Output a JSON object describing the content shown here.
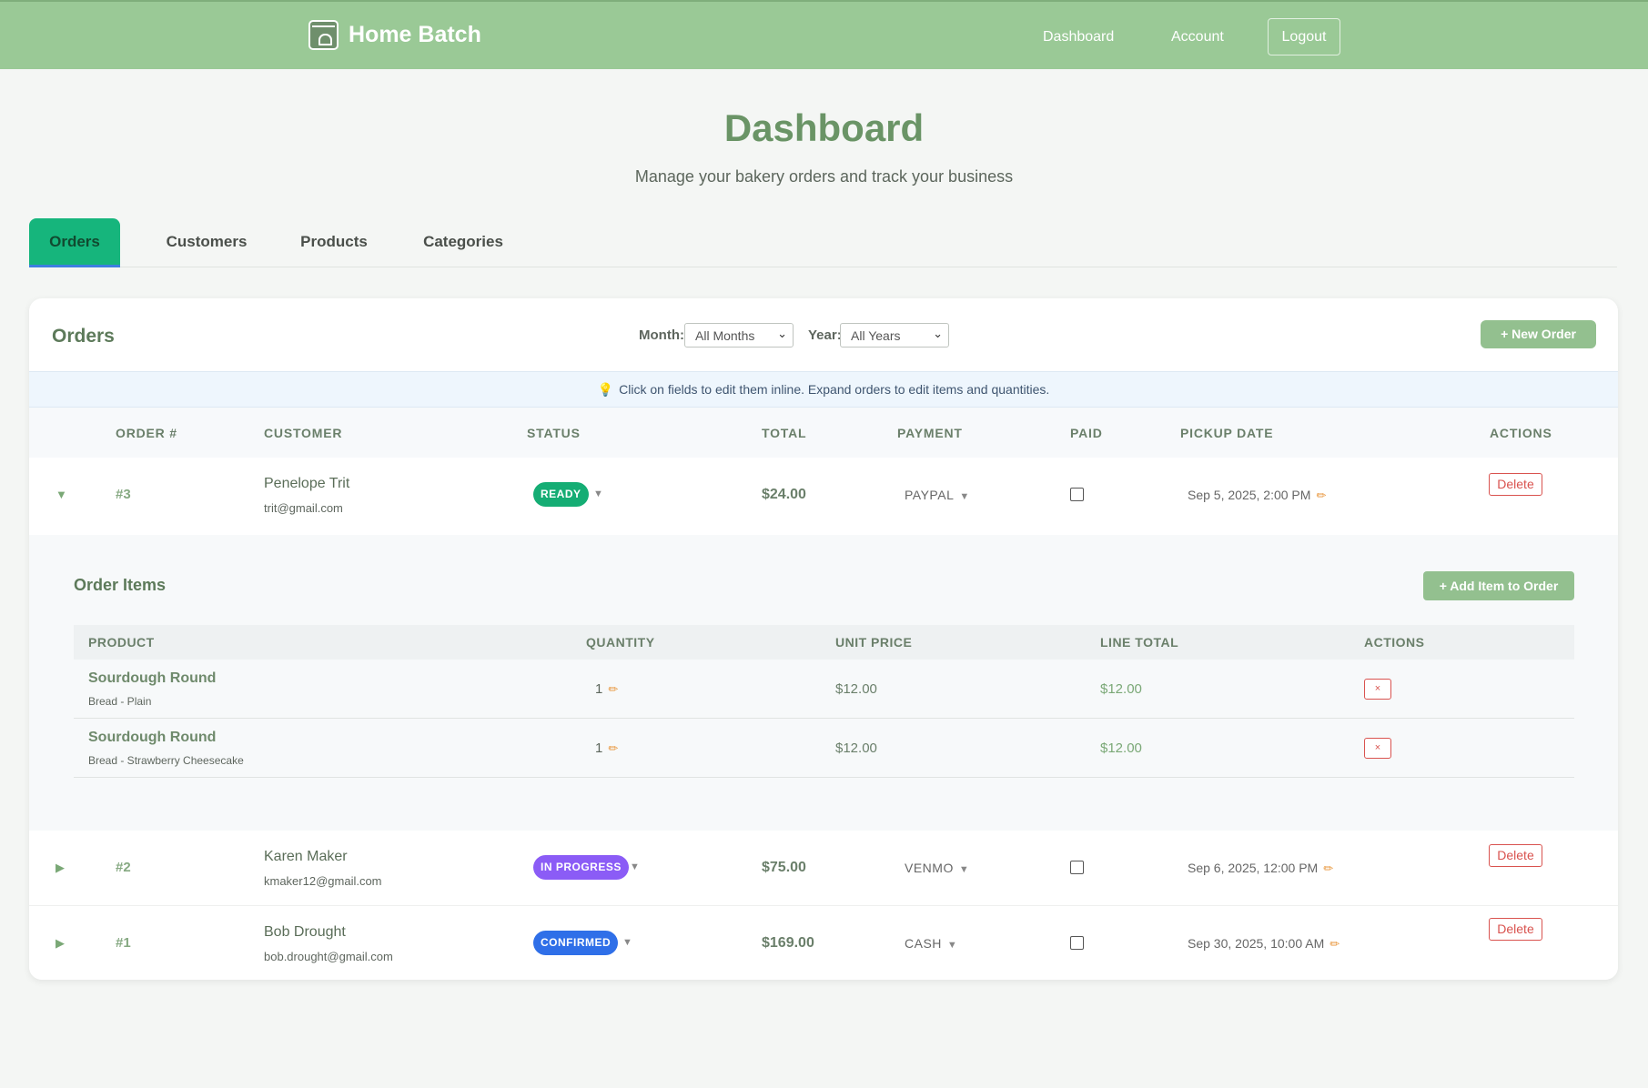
{
  "header": {
    "brand": "Home Batch",
    "nav": {
      "dashboard": "Dashboard",
      "account": "Account",
      "logout": "Logout"
    }
  },
  "page": {
    "title": "Dashboard",
    "subtitle": "Manage your bakery orders and track your business"
  },
  "tabs": [
    {
      "label": "Orders",
      "active": true
    },
    {
      "label": "Customers",
      "active": false
    },
    {
      "label": "Products",
      "active": false
    },
    {
      "label": "Categories",
      "active": false
    }
  ],
  "orders_panel": {
    "title": "Orders",
    "month_label": "Month:",
    "month_value": "All Months",
    "year_label": "Year:",
    "year_value": "All Years",
    "new_order": "+ New Order",
    "info": "Click on fields to edit them inline. Expand orders to edit items and quantities.",
    "info_icon": "lightbulb-icon",
    "columns": [
      "ORDER #",
      "CUSTOMER",
      "STATUS",
      "TOTAL",
      "PAYMENT",
      "PAID",
      "PICKUP DATE",
      "ACTIONS"
    ],
    "delete_label": "Delete"
  },
  "orders": [
    {
      "num": "#3",
      "expanded": true,
      "name": "Penelope Trit",
      "email": "trit@gmail.com",
      "status": "READY",
      "status_color": "#15ad74",
      "total": "$24.00",
      "payment": "PAYPAL",
      "paid": false,
      "pickup": "Sep 5, 2025, 2:00 PM"
    },
    {
      "num": "#2",
      "expanded": false,
      "name": "Karen Maker",
      "email": "kmaker12@gmail.com",
      "status": "IN PROGRESS",
      "status_color": "#8b5cf6",
      "total": "$75.00",
      "payment": "VENMO",
      "paid": false,
      "pickup": "Sep 6, 2025, 12:00 PM"
    },
    {
      "num": "#1",
      "expanded": false,
      "name": "Bob Drought",
      "email": "bob.drought@gmail.com",
      "status": "CONFIRMED",
      "status_color": "#2f6fe8",
      "total": "$169.00",
      "payment": "CASH",
      "paid": false,
      "pickup": "Sep 30, 2025, 10:00 AM"
    }
  ],
  "order_items": {
    "title": "Order Items",
    "add_button": "+ Add Item to Order",
    "columns": [
      "PRODUCT",
      "QUANTITY",
      "UNIT PRICE",
      "LINE TOTAL",
      "ACTIONS"
    ],
    "remove_label": "×",
    "items": [
      {
        "product": "Sourdough Round",
        "variant": "Bread - Plain",
        "qty": "1",
        "unit": "$12.00",
        "line": "$12.00"
      },
      {
        "product": "Sourdough Round",
        "variant": "Bread - Strawberry Cheesecake",
        "qty": "1",
        "unit": "$12.00",
        "line": "$12.00"
      }
    ]
  },
  "colors": {
    "header_bg": "#9ac996",
    "accent": "#6a9466",
    "active_tab": "#16b57c",
    "danger": "#d9534f"
  }
}
